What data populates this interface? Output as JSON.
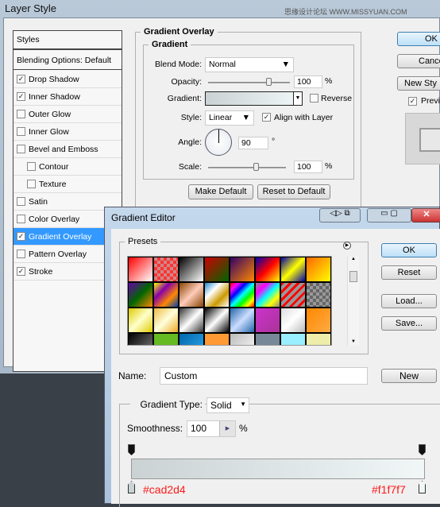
{
  "layer_style": {
    "title": "Layer Style",
    "watermark": "思缘设计论坛 WWW.MISSYUAN.COM",
    "styles_header": "Styles",
    "blending": "Blending Options: Default",
    "items": [
      {
        "label": "Drop Shadow",
        "checked": true,
        "sub": false
      },
      {
        "label": "Inner Shadow",
        "checked": true,
        "sub": false
      },
      {
        "label": "Outer Glow",
        "checked": false,
        "sub": false
      },
      {
        "label": "Inner Glow",
        "checked": false,
        "sub": false
      },
      {
        "label": "Bevel and Emboss",
        "checked": false,
        "sub": false
      },
      {
        "label": "Contour",
        "checked": false,
        "sub": true
      },
      {
        "label": "Texture",
        "checked": false,
        "sub": true
      },
      {
        "label": "Satin",
        "checked": false,
        "sub": false
      },
      {
        "label": "Color Overlay",
        "checked": false,
        "sub": false
      },
      {
        "label": "Gradient Overlay",
        "checked": true,
        "sub": false,
        "selected": true
      },
      {
        "label": "Pattern Overlay",
        "checked": false,
        "sub": false
      },
      {
        "label": "Stroke",
        "checked": true,
        "sub": false
      }
    ],
    "section": "Gradient Overlay",
    "group": "Gradient",
    "blend_mode_label": "Blend Mode:",
    "blend_mode": "Normal",
    "opacity_label": "Opacity:",
    "opacity": "100",
    "opacity_pct": 75,
    "gradient_label": "Gradient:",
    "reverse_label": "Reverse",
    "reverse": false,
    "style_label": "Style:",
    "style": "Linear",
    "align_label": "Align with Layer",
    "align": true,
    "angle_label": "Angle:",
    "angle": "90",
    "degree": "°",
    "scale_label": "Scale:",
    "scale": "100",
    "scale_pct": 50,
    "percent": "%",
    "make_default": "Make Default",
    "reset_default": "Reset to Default",
    "ok": "OK",
    "cancel": "Cance",
    "new_style": "New Sty",
    "preview": "Previ"
  },
  "gradient_editor": {
    "title": "Gradient Editor",
    "presets_label": "Presets",
    "ok": "OK",
    "reset": "Reset",
    "load": "Load...",
    "save": "Save...",
    "name_label": "Name:",
    "name": "Custom",
    "new": "New",
    "type_label": "Gradient Type:",
    "type": "Solid",
    "smoothness_label": "Smoothness:",
    "smoothness": "100",
    "percent": "%",
    "stop_left": "#cad2d4",
    "stop_right": "#f1f7f7",
    "annotation_color": "#ff1a1a"
  }
}
